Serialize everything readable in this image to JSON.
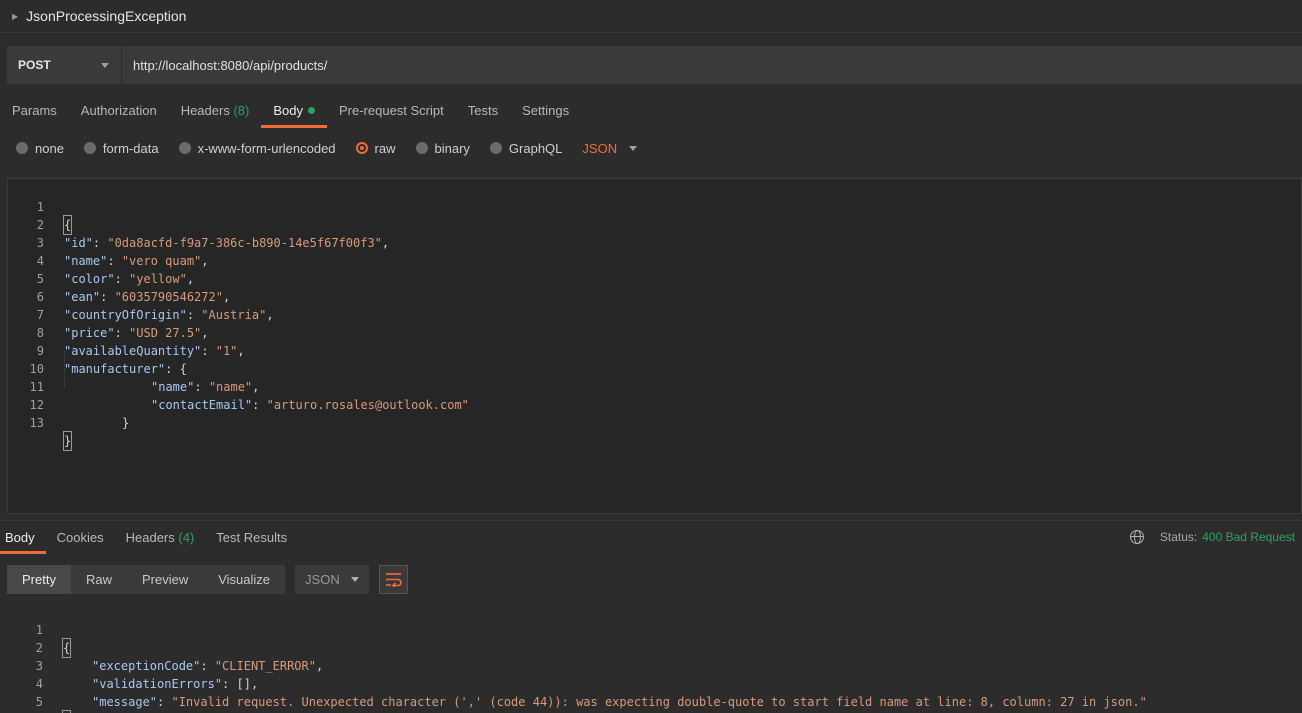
{
  "request": {
    "name": "JsonProcessingException",
    "method": "POST",
    "url": "http://localhost:8080/api/products/"
  },
  "request_tabs": [
    {
      "label": "Params"
    },
    {
      "label": "Authorization"
    },
    {
      "label": "Headers",
      "count": "(8)"
    },
    {
      "label": "Body"
    },
    {
      "label": "Pre-request Script"
    },
    {
      "label": "Tests"
    },
    {
      "label": "Settings"
    }
  ],
  "body_types": {
    "options": [
      "none",
      "form-data",
      "x-www-form-urlencoded",
      "raw",
      "binary",
      "GraphQL"
    ],
    "selected": "raw",
    "language": "JSON"
  },
  "request_body_lines": [
    {
      "n": "1",
      "text": "{"
    },
    {
      "n": "2",
      "key": "\"id\"",
      "value": "\"0da8acfd-f9a7-386c-b890-14e5f67f00f3\"",
      "tail": ","
    },
    {
      "n": "3",
      "key": "\"name\"",
      "value": "\"vero quam\"",
      "tail": ","
    },
    {
      "n": "4",
      "key": "\"color\"",
      "value": "\"yellow\"",
      "tail": ","
    },
    {
      "n": "5",
      "key": "\"ean\"",
      "value": "\"6035790546272\"",
      "tail": ","
    },
    {
      "n": "6",
      "key": "\"countryOfOrigin\"",
      "value": "\"Austria\"",
      "tail": ","
    },
    {
      "n": "7",
      "key": "\"price\"",
      "value": "\"USD 27.5\"",
      "tail": ","
    },
    {
      "n": "8",
      "key": "\"availableQuantity\"",
      "value": "\"1\"",
      "tail": ","
    },
    {
      "n": "9",
      "key": "\"manufacturer\"",
      "tail": ": {"
    },
    {
      "n": "10",
      "key": "\"name\"",
      "value": "\"name\"",
      "tail": ","
    },
    {
      "n": "11",
      "key": "\"contactEmail\"",
      "value": "\"arturo.rosales@outlook.com\"",
      "tail": ""
    },
    {
      "n": "12",
      "text": "}"
    },
    {
      "n": "13",
      "text": "}"
    }
  ],
  "response_tabs": [
    {
      "label": "Body"
    },
    {
      "label": "Cookies"
    },
    {
      "label": "Headers",
      "count": "(4)"
    },
    {
      "label": "Test Results"
    }
  ],
  "response_status": {
    "label": "Status:",
    "value": "400 Bad Request"
  },
  "view_modes": [
    "Pretty",
    "Raw",
    "Preview",
    "Visualize"
  ],
  "response_format": "JSON",
  "response_body_lines": [
    {
      "n": "1",
      "text": "{"
    },
    {
      "n": "2",
      "key": "\"exceptionCode\"",
      "value": "\"CLIENT_ERROR\"",
      "tail": ","
    },
    {
      "n": "3",
      "key": "\"validationErrors\"",
      "value": "[]",
      "tail": ","
    },
    {
      "n": "4",
      "key": "\"message\"",
      "value": "\"Invalid request. Unexpected character (',' (code 44)): was expecting double-quote to start field name at line: 8, column: 27 in json.\"",
      "tail": ""
    },
    {
      "n": "5",
      "text": "}"
    }
  ],
  "colors": {
    "accent": "#f26b3a",
    "success": "#2fa05f",
    "json_key": "#a8c8f0",
    "json_string": "#d89a7a"
  }
}
